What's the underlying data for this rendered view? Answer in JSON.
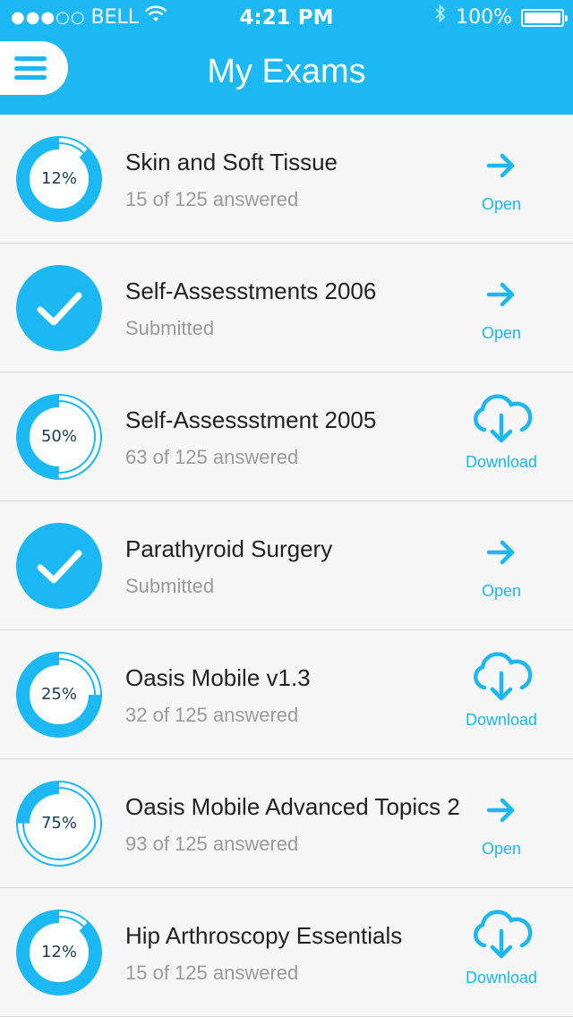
{
  "status_bar": {
    "signal": "●●●○○",
    "carrier": "BELL",
    "time": "4:21 PM",
    "battery": "100%"
  },
  "header": {
    "title": "My Exams",
    "menu_icon": "hamburger-menu-icon"
  },
  "colors": {
    "accent": "#1bb8f4",
    "track": "#cfefff",
    "subtext": "#9a9a9a",
    "divider": "#d9d9d9"
  },
  "exams": [
    {
      "title": "Skin and Soft Tissue",
      "status": "15 of 125 answered",
      "state": "progress",
      "percent": "12%",
      "progress": 0.12,
      "action": "Open",
      "action_icon": "arrow-right-icon"
    },
    {
      "title": "Self-Assesstments 2006",
      "status": "Submitted",
      "state": "submitted",
      "percent": "",
      "progress": 1,
      "action": "Open",
      "action_icon": "arrow-right-icon"
    },
    {
      "title": "Self-Assessstment 2005",
      "status": "63 of 125 answered",
      "state": "progress",
      "percent": "50%",
      "progress": 0.5,
      "action": "Download",
      "action_icon": "cloud-download-icon"
    },
    {
      "title": "Parathyroid Surgery",
      "status": "Submitted",
      "state": "submitted",
      "percent": "",
      "progress": 1,
      "action": "Open",
      "action_icon": "arrow-right-icon"
    },
    {
      "title": "Oasis Mobile v1.3",
      "status": "32 of 125 answered",
      "state": "progress",
      "percent": "25%",
      "progress": 0.25,
      "action": "Download",
      "action_icon": "cloud-download-icon"
    },
    {
      "title": "Oasis Mobile Advanced Topics 2",
      "status": "93 of 125 answered",
      "state": "progress",
      "percent": "75%",
      "progress": 0.75,
      "action": "Open",
      "action_icon": "arrow-right-icon"
    },
    {
      "title": "Hip Arthroscopy Essentials",
      "status": "15 of 125 answered",
      "state": "progress",
      "percent": "12%",
      "progress": 0.12,
      "action": "Download",
      "action_icon": "cloud-download-icon"
    }
  ]
}
